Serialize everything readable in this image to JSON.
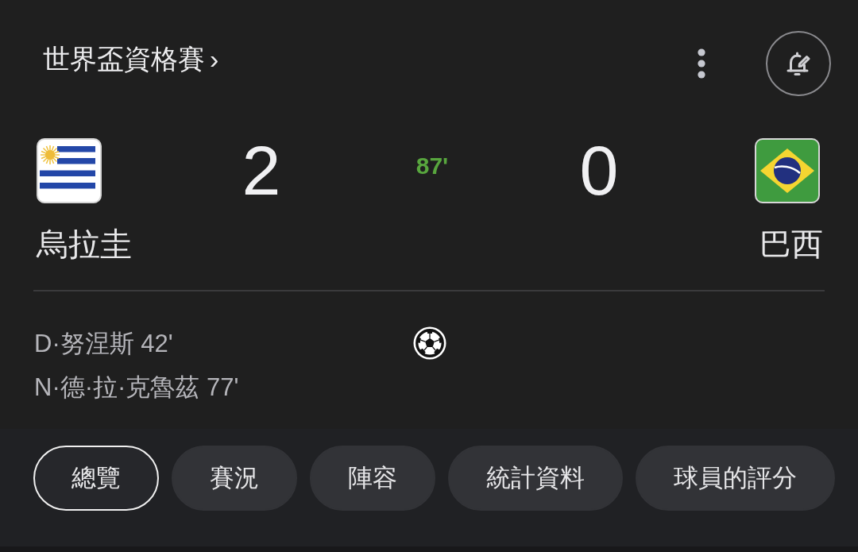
{
  "header": {
    "title": "世界盃資格賽",
    "chevron": "›"
  },
  "match": {
    "minute": "87'",
    "teams": [
      {
        "name": "烏拉圭",
        "score": "2",
        "goals": [
          "D·努涅斯 42'",
          "N·德·拉·克魯茲 77'"
        ]
      },
      {
        "name": "巴西",
        "score": "0"
      }
    ]
  },
  "tabs": [
    {
      "label": "總覽",
      "selected": true
    },
    {
      "label": "賽況",
      "selected": false
    },
    {
      "label": "陣容",
      "selected": false
    },
    {
      "label": "統計資料",
      "selected": false
    },
    {
      "label": "球員的評分",
      "selected": false
    }
  ]
}
